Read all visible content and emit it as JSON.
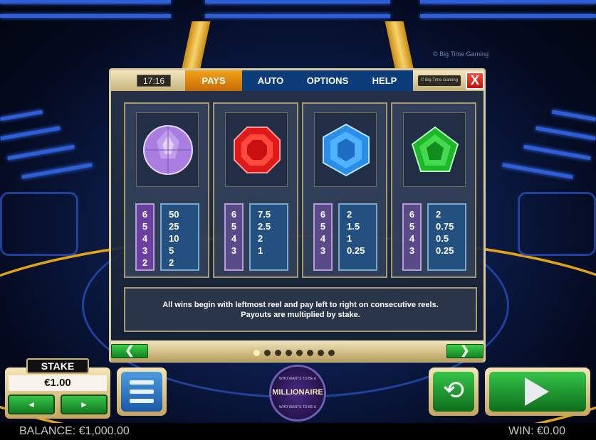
{
  "background": {
    "credit": "© Big Time Gaming"
  },
  "paytable": {
    "clock": "17:16",
    "tabs": [
      {
        "label": "PAYS",
        "active": true
      },
      {
        "label": "AUTO",
        "active": false
      },
      {
        "label": "OPTIONS",
        "active": false
      },
      {
        "label": "HELP",
        "active": false
      }
    ],
    "brand_badge": "© Big Time Gaming",
    "close_label": "X",
    "symbols": [
      {
        "icon": "purple-diamond-icon",
        "color": "#a97ee0",
        "counts": [
          "6",
          "5",
          "4",
          "3",
          "2"
        ],
        "payouts": [
          "50",
          "25",
          "10",
          "5",
          "2"
        ]
      },
      {
        "icon": "red-octagon-gem-icon",
        "color": "#e01a1a",
        "counts": [
          "6",
          "5",
          "4",
          "3"
        ],
        "payouts": [
          "7.5",
          "2.5",
          "2",
          "1"
        ]
      },
      {
        "icon": "blue-hexagon-gem-icon",
        "color": "#2a8de8",
        "counts": [
          "6",
          "5",
          "4",
          "3"
        ],
        "payouts": [
          "2",
          "1.5",
          "1",
          "0.25"
        ]
      },
      {
        "icon": "green-pentagon-gem-icon",
        "color": "#1db82a",
        "counts": [
          "6",
          "5",
          "4",
          "3"
        ],
        "payouts": [
          "2",
          "0.75",
          "0.5",
          "0.25"
        ]
      }
    ],
    "info_line1": "All wins begin with leftmost reel and pay left to right on consecutive reels.",
    "info_line2": "Payouts are multiplied by stake.",
    "nav": {
      "prev_label": "❮",
      "next_label": "❯",
      "page_count": 8,
      "current_page": 1
    }
  },
  "controls": {
    "stake_label": "STAKE",
    "stake_value": "€1.00",
    "stake_minus": "◄",
    "stake_plus": "►",
    "logo_title": "MILLIONAIRE",
    "logo_top": "WHO WANTS TO BE A",
    "logo_bottom": "WHO WANTS TO BE A",
    "autoplay_glyph": "⟲"
  },
  "footer": {
    "balance": "BALANCE: €1,000.00",
    "win": "WIN: €0.00"
  }
}
